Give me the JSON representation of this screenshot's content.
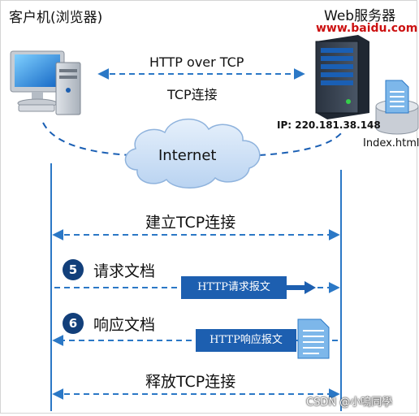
{
  "client": {
    "label": "客户机(浏览器)"
  },
  "server": {
    "label": "Web服务器",
    "url": "www.baidu.com",
    "ip": "IP: 220.181.38.148",
    "file": "Index.html"
  },
  "top_link": {
    "protocol": "HTTP over TCP",
    "connection": "TCP连接"
  },
  "network": {
    "label": "Internet"
  },
  "steps": {
    "establish": "建立TCP连接",
    "request": {
      "number": "5",
      "label": "请求文档",
      "message": "HTTP请求报文"
    },
    "response": {
      "number": "6",
      "label": "响应文档",
      "message": "HTTP响应报文"
    },
    "release": "释放TCP连接"
  },
  "watermark": "CSDN @小鳴同學",
  "colors": {
    "arrow": "#2b78c6",
    "message_box": "#1d5fb0",
    "step_circle": "#123f7a",
    "url_text": "#cc1111",
    "cloud_fill": "#cfe1f7"
  }
}
